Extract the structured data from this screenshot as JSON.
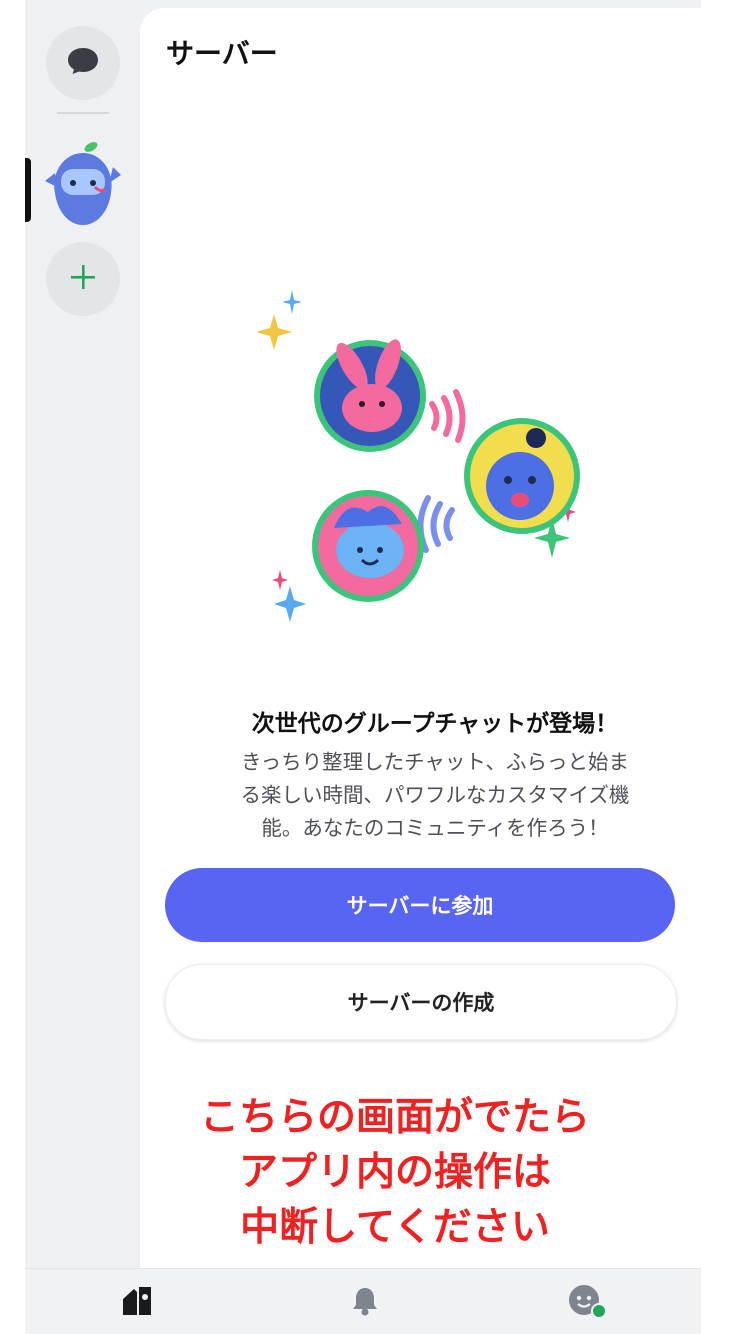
{
  "panel": {
    "title": "サーバー",
    "headline": "次世代のグループチャットが登場！",
    "description_lines": [
      "きっちり整理したチャット、ふらっと始ま",
      "る楽しい時間、パワフルなカスタマイズ機",
      "能。あなたのコミュニティを作ろう！"
    ],
    "join_button": "サーバーに参加",
    "create_button": "サーバーの作成"
  },
  "notice": {
    "lines": [
      "こちらの画面がでたら",
      "アプリ内の操作は",
      "中断してください"
    ],
    "color": "#ee2222"
  },
  "rail": {
    "items": [
      {
        "icon": "chat-bubble-icon"
      },
      {
        "icon": "mascot-server-icon"
      },
      {
        "icon": "plus-icon"
      }
    ]
  },
  "tabs": [
    {
      "icon": "servers-home-icon"
    },
    {
      "icon": "bell-icon"
    },
    {
      "icon": "profile-avatar-icon"
    }
  ],
  "colors": {
    "accent": "#5865f2",
    "online": "#23a55a",
    "plus": "#23a55a"
  }
}
